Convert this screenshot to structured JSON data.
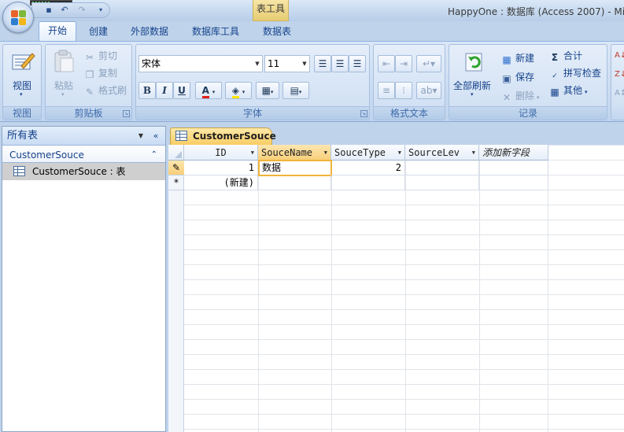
{
  "title_bar": {
    "app_title": "HappyOne : 数据库 (Access 2007) - Mi",
    "context_tab": "表工具",
    "qat": [
      "save-icon",
      "undo-icon",
      "redo-icon",
      "customize-icon"
    ]
  },
  "tabs": [
    {
      "label": "开始",
      "active": true
    },
    {
      "label": "创建",
      "active": false
    },
    {
      "label": "外部数据",
      "active": false
    },
    {
      "label": "数据库工具",
      "active": false
    },
    {
      "label": "数据表",
      "active": false
    }
  ],
  "ribbon": {
    "view": {
      "button": "视图",
      "group": "视图"
    },
    "clipboard": {
      "paste": "粘贴",
      "cut": "剪切",
      "copy": "复制",
      "format_painter": "格式刷",
      "group": "剪贴板"
    },
    "font": {
      "font_name": "宋体",
      "font_size": "11",
      "bold": "B",
      "italic": "I",
      "underline": "U",
      "font_color": "A",
      "group": "字体"
    },
    "rich_text": {
      "group": "格式文本"
    },
    "records": {
      "refresh_all": "全部刷新",
      "new": "新建",
      "save": "保存",
      "delete": "删除",
      "totals": "合计",
      "spelling": "拼写检查",
      "more": "其他",
      "group": "记录"
    }
  },
  "nav_pane": {
    "header": "所有表",
    "group": "CustomerSouce",
    "items": [
      {
        "label": "CustomerSouce : 表"
      }
    ]
  },
  "document": {
    "tab_label": "CustomerSouce",
    "columns": [
      "ID",
      "SouceName",
      "SouceType",
      "SourceLev",
      "添加新字段"
    ],
    "rows": [
      {
        "selector": "✎",
        "ID": "1",
        "SouceName": "数据",
        "SouceType": "2",
        "SourceLev": "",
        "extra": ""
      },
      {
        "selector": "*",
        "ID": "(新建)",
        "SouceName": "",
        "SouceType": "",
        "SourceLev": "",
        "extra": ""
      }
    ]
  },
  "colors": {
    "accent": "#f8cb62",
    "ribbon_text": "#15428b"
  }
}
